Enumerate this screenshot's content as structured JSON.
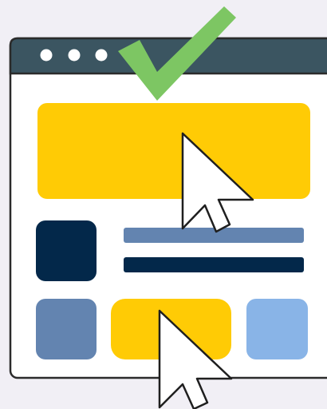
{
  "illustration": {
    "colors": {
      "background": "#f1eff5",
      "window_fill": "#ffffff",
      "window_outline": "#2b2b2b",
      "titlebar": "#3b5561",
      "window_dots": "#ffffff",
      "checkmark": "#7dc663",
      "hero_banner": "#ffcb05",
      "thumbnail": "#03284a",
      "text_line_light": "#6384b0",
      "text_line_dark": "#03284a",
      "tile_left": "#6384b0",
      "tile_center": "#ffcb05",
      "tile_right": "#89b4e7",
      "cursor_fill": "#ffffff",
      "cursor_outline": "#1f1f1f"
    },
    "icons": {
      "window": "browser-window-icon",
      "window_dots": "window-controls-icon",
      "check": "checkmark-icon",
      "cursor": "mouse-pointer-icon"
    }
  }
}
